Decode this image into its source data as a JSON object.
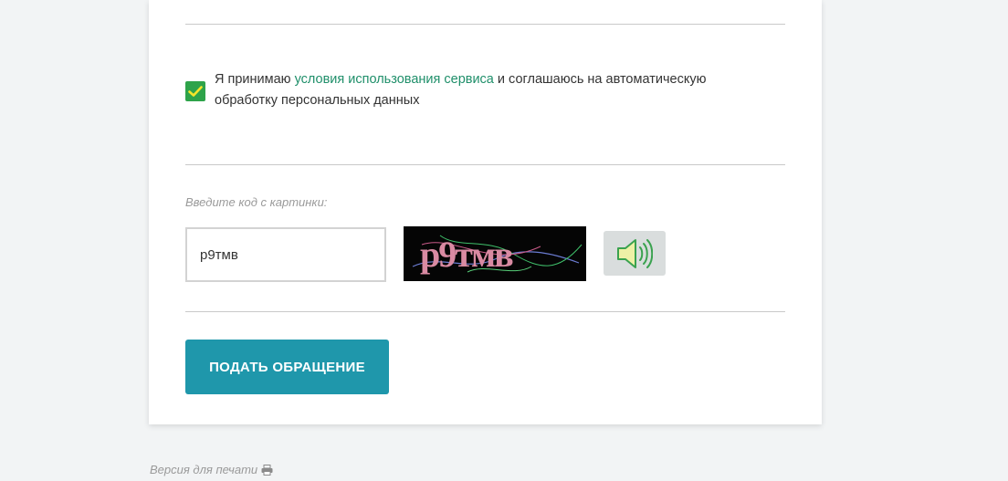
{
  "consent": {
    "checked": true,
    "text_before": "Я принимаю ",
    "link_text": "условия использования сервиса",
    "text_after": " и соглашаюсь на автоматическую обработку персональных данных"
  },
  "captcha": {
    "label": "Введите код с картинки:",
    "input_value": "p9тмв",
    "image_text": "р9тмв",
    "audio_icon": "speaker-icon"
  },
  "submit": {
    "label": "ПОДАТЬ ОБРАЩЕНИЕ"
  },
  "footer": {
    "print_label": "Версия для печати",
    "print_icon": "printer-icon"
  },
  "colors": {
    "accent_green": "#2ea34a",
    "link_green": "#1f8f6a",
    "button_teal": "#1f97ab"
  }
}
